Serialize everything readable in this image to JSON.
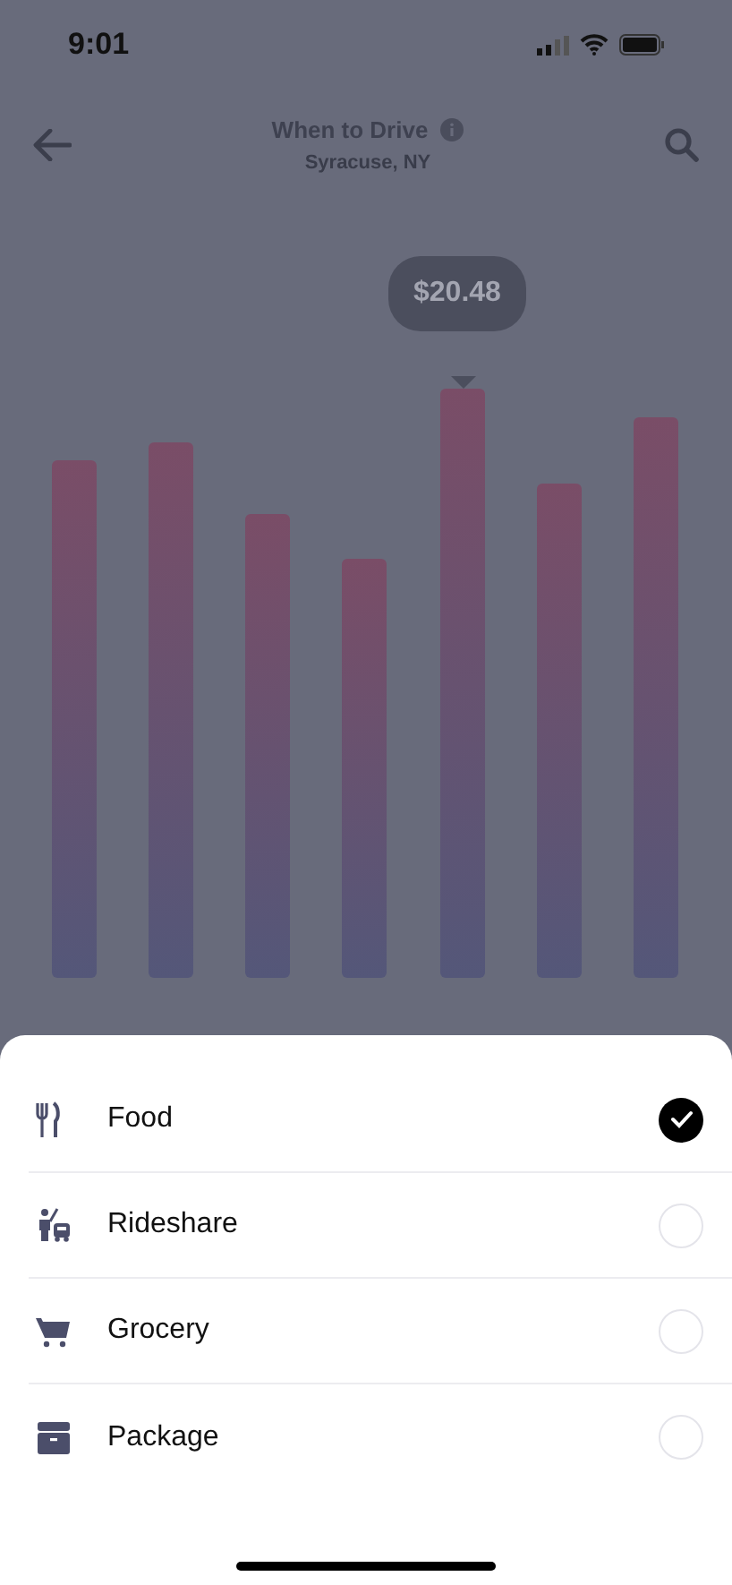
{
  "status_bar": {
    "time": "9:01"
  },
  "header": {
    "title": "When to Drive",
    "subtitle": "Syracuse, NY"
  },
  "chart": {
    "tooltip": "$20.48"
  },
  "options": [
    {
      "label": "Food",
      "selected": true
    },
    {
      "label": "Rideshare",
      "selected": false
    },
    {
      "label": "Grocery",
      "selected": false
    },
    {
      "label": "Package",
      "selected": false
    }
  ]
}
